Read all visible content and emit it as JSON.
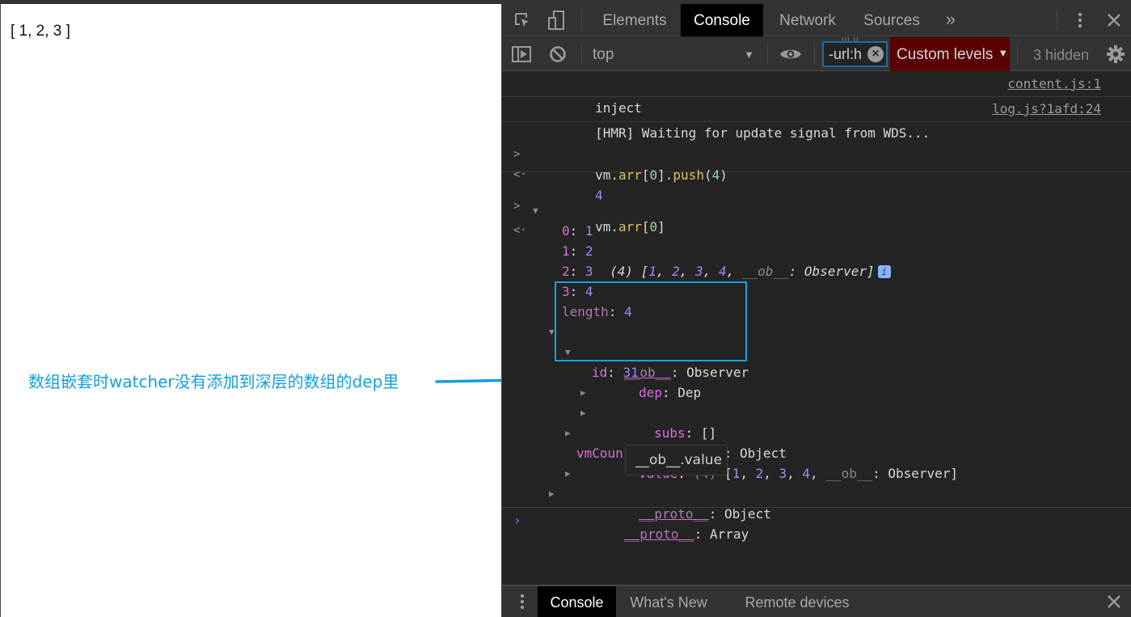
{
  "page": {
    "array_text": "[ 1, 2, 3 ]",
    "annotation": "数组嵌套时watcher没有添加到深层的数组的dep里",
    "annotation_color": "#129fdc"
  },
  "devtools": {
    "tabs": [
      {
        "label": "Elements",
        "active": false
      },
      {
        "label": "Console",
        "active": true
      },
      {
        "label": "Network",
        "active": false
      },
      {
        "label": "Sources",
        "active": false
      }
    ],
    "more_tabs_glyph": "»",
    "toolbar": {
      "context": "top",
      "filter_value": "-url:h",
      "levels_label": "Custom levels",
      "hidden_count": "3 hidden"
    },
    "messages": [
      {
        "text": "inject",
        "source": "content.js:1"
      },
      {
        "text": "[HMR] Waiting for update signal from WDS...",
        "source": "log.js?1afd:24"
      }
    ],
    "cmd1": {
      "obj": "vm.",
      "prop": "arr",
      "open": "[",
      "idx": "0",
      "close": "].",
      "method": "push",
      "lp": "(",
      "arg": "4",
      "rp": ")",
      "result": "4"
    },
    "cmd2": {
      "obj": "vm.",
      "prop": "arr",
      "open": "[",
      "idx": "0",
      "close": "]"
    },
    "result_summary": {
      "count": "(4)",
      "open": " [",
      "items": [
        "1",
        "2",
        "3",
        "4"
      ],
      "ob_key": "__ob__",
      "ob_val": "Observer",
      "close": "]"
    },
    "tree": {
      "entries": [
        {
          "key": "0",
          "value": "1"
        },
        {
          "key": "1",
          "value": "2"
        },
        {
          "key": "2",
          "value": "3"
        },
        {
          "key": "3",
          "value": "4"
        }
      ],
      "length_key": "length",
      "length_val": "4",
      "ob_key": "__ob__",
      "ob_type": "Observer",
      "dep_key": "dep",
      "dep_type": "Dep",
      "id_key": "id",
      "id_val": "31",
      "subs_key": "subs",
      "subs_val": "[]",
      "proto_key": "__proto__",
      "proto_obj": "Object",
      "value_key": "value",
      "value_count": "(4)",
      "value_items": [
        "1",
        "2",
        "3",
        "4"
      ],
      "value_ob": "__ob__",
      "value_ob_type": "Observer",
      "vmcount_key": "vmCoun",
      "proto2_key": "__proto__",
      "proto2_type": "Object",
      "proto3_key": "__proto__",
      "proto3_type": "Array"
    },
    "tooltip": "__ob__.value",
    "drawer_tabs": [
      {
        "label": "Console",
        "active": true
      },
      {
        "label": "What's New",
        "active": false
      },
      {
        "label": "Remote devices",
        "active": false
      }
    ]
  }
}
